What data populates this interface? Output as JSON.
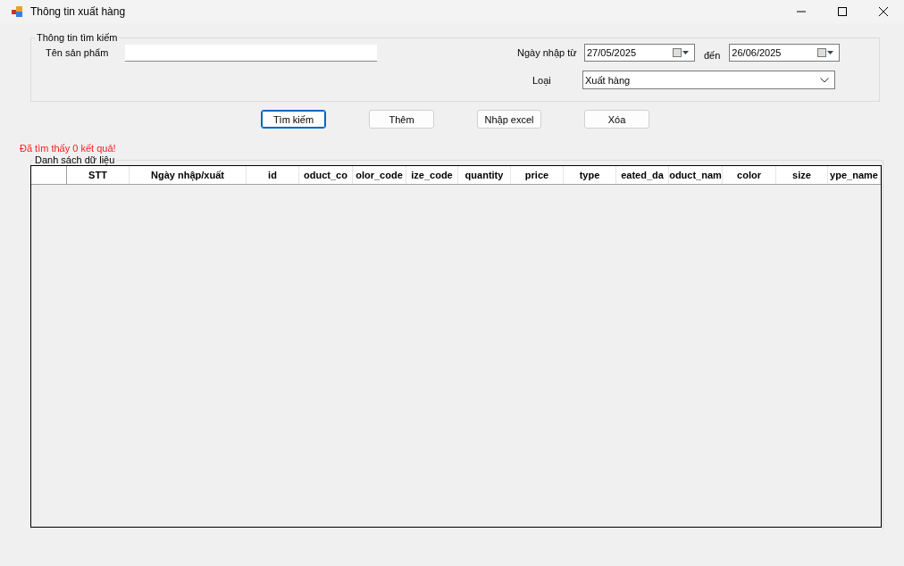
{
  "window": {
    "title": "Thông tin xuất hàng"
  },
  "search_group": {
    "title": "Thông tin tìm kiếm",
    "product_name_label": "Tên sản phẩm",
    "date_from_label": "Ngày nhập từ",
    "date_from": "27/05/2025",
    "date_to_label": "đến",
    "date_to": "26/06/2025",
    "type_label": "Loại",
    "type_value": "Xuất hàng"
  },
  "buttons": [
    {
      "label": "Tìm kiếm",
      "focused": true
    },
    {
      "label": "Thêm",
      "focused": false
    },
    {
      "label": "Nhập excel",
      "focused": false
    },
    {
      "label": "Xóa",
      "focused": false
    }
  ],
  "result_message": "Đã tìm thấy 0 kết quả!",
  "data_group": {
    "title": "Danh sách dữ liệu"
  },
  "table": {
    "columns": [
      "STT",
      "Ngày nhập/xuất",
      "id",
      "oduct_co",
      "olor_code",
      "ize_code",
      "quantity",
      "price",
      "type",
      "eated_da",
      "oduct_nam",
      "color",
      "size",
      "ype_name"
    ]
  }
}
